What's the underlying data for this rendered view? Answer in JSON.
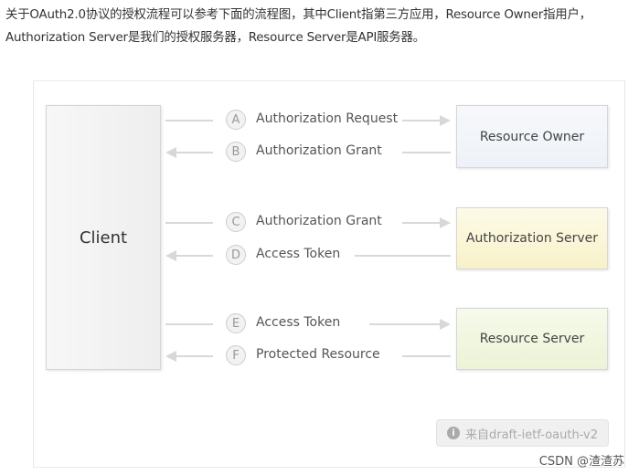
{
  "intro": {
    "line1": "关于OAuth2.0协议的授权流程可以参考下面的流程图，其中Client指第三方应用，Resource Owner指用户，",
    "line2": "Authorization Server是我们的授权服务器，Resource Server是API服务器。"
  },
  "diagram": {
    "client": "Client",
    "resource_owner": "Resource Owner",
    "authorization_server": "Authorization Server",
    "resource_server": "Resource Server",
    "flows": [
      {
        "letter": "A",
        "label": "Authorization Request",
        "direction": "right"
      },
      {
        "letter": "B",
        "label": "Authorization Grant",
        "direction": "left"
      },
      {
        "letter": "C",
        "label": "Authorization Grant",
        "direction": "right"
      },
      {
        "letter": "D",
        "label": "Access Token",
        "direction": "left"
      },
      {
        "letter": "E",
        "label": "Access Token",
        "direction": "right"
      },
      {
        "letter": "F",
        "label": "Protected Resource",
        "direction": "left"
      }
    ],
    "source": "来自draft-ietf-oauth-v2",
    "info_icon": "info-circle-icon"
  },
  "watermark": "CSDN @渣渣苏",
  "colors": {
    "owner_box": "#eef2f8",
    "auth_server_box": "#f7f1c9",
    "resource_server_box": "#ecf3d6",
    "client_box": "#eeeeee"
  }
}
